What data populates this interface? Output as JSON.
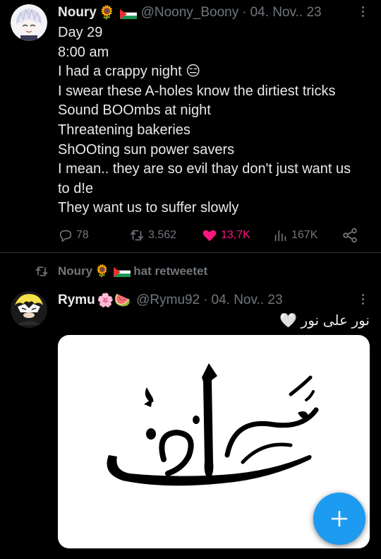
{
  "tweet1": {
    "author_name": "Noury",
    "author_emoji": "🌻",
    "handle": "@Noony_Boony",
    "separator": "·",
    "date": "04. Nov.. 23",
    "lines": [
      "Day 29",
      "8:00 am",
      "I had a crappy night",
      "I swear these A-holes know the dirtiest tricks",
      "Sound BOOmbs at night",
      "Threatening bakeries",
      "ShOOting sun power savers",
      "I mean.. they are so evil thay don't just want us",
      "to d!e",
      "They want us to suffer slowly"
    ],
    "line3_emoji": "😑",
    "actions": {
      "replies": "78",
      "retweets": "3.562",
      "likes": "13,7K",
      "views": "167K"
    }
  },
  "retweet_banner": {
    "name": "Noury",
    "emoji": "🌻",
    "text": "hat retweetet"
  },
  "tweet2": {
    "author_name": "Rymu",
    "author_emoji": "🌸🍉",
    "handle": "@Rymu92",
    "separator": "·",
    "date": "04. Nov.. 23",
    "text": "نور على نور",
    "text_emoji": "🤍"
  },
  "colors": {
    "background": "#000000",
    "text": "#e7e9ea",
    "muted": "#71767b",
    "like": "#f91880",
    "accent": "#1d9bf0"
  },
  "icons": [
    "more-icon",
    "reply-icon",
    "retweet-icon",
    "like-icon",
    "views-icon",
    "share-icon",
    "compose-plus-icon",
    "palestine-flag-icon"
  ]
}
